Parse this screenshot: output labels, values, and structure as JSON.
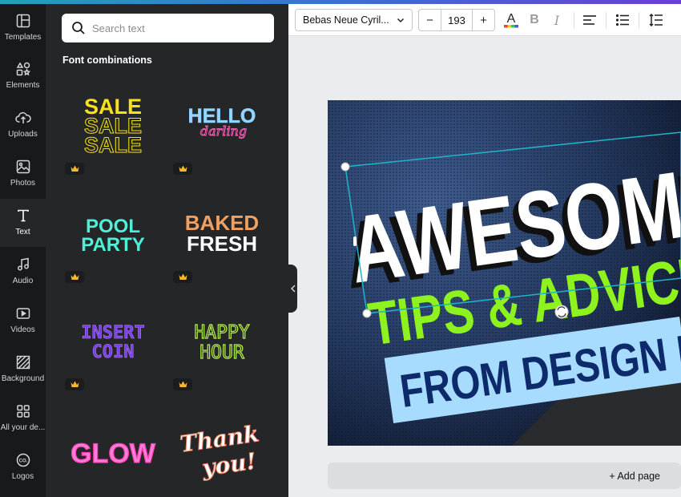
{
  "sidebar": {
    "items": [
      {
        "label": "Templates",
        "icon": "templates-icon"
      },
      {
        "label": "Elements",
        "icon": "elements-icon"
      },
      {
        "label": "Uploads",
        "icon": "uploads-icon"
      },
      {
        "label": "Photos",
        "icon": "photos-icon"
      },
      {
        "label": "Text",
        "icon": "text-icon",
        "active": true
      },
      {
        "label": "Audio",
        "icon": "audio-icon"
      },
      {
        "label": "Videos",
        "icon": "videos-icon"
      },
      {
        "label": "Background",
        "icon": "background-icon"
      },
      {
        "label": "All your de...",
        "icon": "all-designs-icon"
      },
      {
        "label": "Logos",
        "icon": "logos-icon"
      }
    ]
  },
  "panel": {
    "search_placeholder": "Search text",
    "section_title": "Font combinations",
    "tiles": [
      {
        "lines": [
          "SALE",
          "SALE",
          "SALE"
        ],
        "premium": true
      },
      {
        "lines": [
          "HELLO",
          "darling"
        ],
        "premium": true
      },
      {
        "lines": [
          "POOL",
          "PARTY"
        ],
        "premium": true
      },
      {
        "lines": [
          "BAKED",
          "FRESH"
        ],
        "premium": true
      },
      {
        "lines": [
          "INSERT",
          "COIN"
        ],
        "premium": true
      },
      {
        "lines": [
          "HAPPY",
          "HOUR"
        ],
        "premium": true
      },
      {
        "lines": [
          "GLOW"
        ],
        "premium": false
      },
      {
        "lines": [
          "Thank",
          "you!"
        ],
        "premium": false
      }
    ]
  },
  "toolbar": {
    "font_name": "Bebas Neue Cyril...",
    "font_size": "193",
    "minus_label": "−",
    "plus_label": "+",
    "bold_label": "B",
    "italic_label": "I",
    "text_color_letter": "A"
  },
  "canvas": {
    "lines": [
      "AWESOME",
      "TIPS & ADVICE",
      "FROM DESIGN HUB"
    ],
    "colors": {
      "headline": "#ffffff",
      "accent": "#8ef21e",
      "banner": "#a8dcff",
      "banner_text": "#0d2a6b",
      "selection": "#1fb5c9"
    }
  },
  "footer": {
    "add_page_label": "+ Add page"
  }
}
